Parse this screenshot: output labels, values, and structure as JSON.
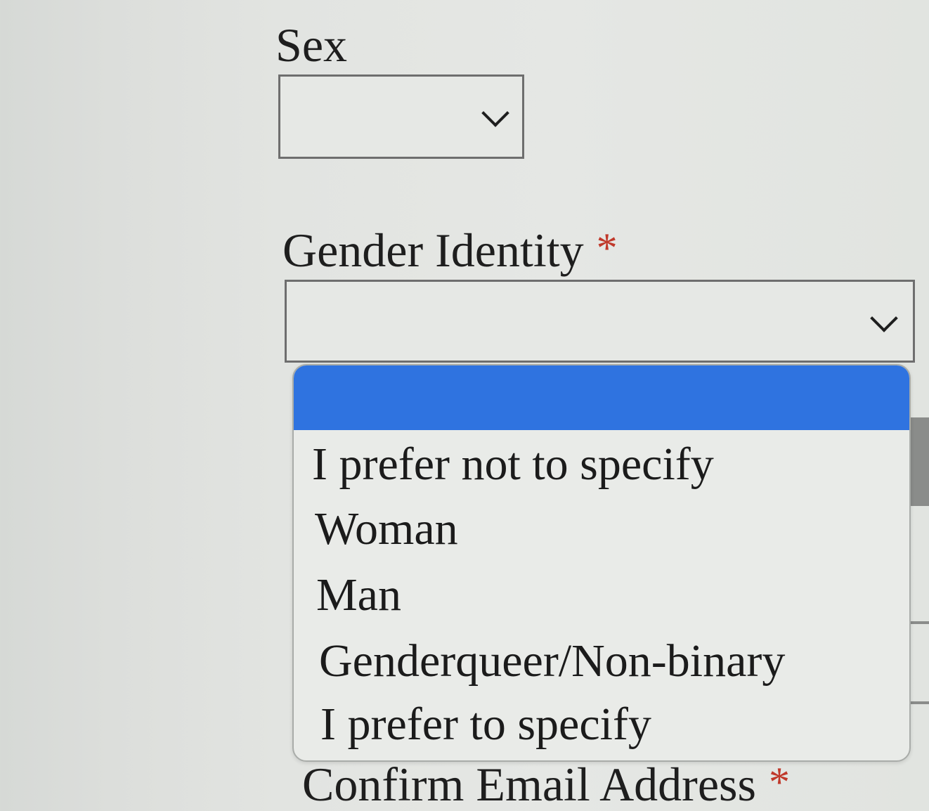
{
  "form": {
    "sex": {
      "label": "Sex",
      "selected_value": ""
    },
    "gender_identity": {
      "label": "Gender Identity",
      "required_marker": "*",
      "selected_value": "",
      "options": [
        {
          "label": "",
          "highlighted": true
        },
        {
          "label": "I prefer not to specify",
          "highlighted": false
        },
        {
          "label": "Woman",
          "highlighted": false
        },
        {
          "label": "Man",
          "highlighted": false
        },
        {
          "label": "Genderqueer/Non-binary",
          "highlighted": false
        },
        {
          "label": "I prefer to specify",
          "highlighted": false
        }
      ]
    },
    "confirm_email": {
      "label": "Confirm Email Address",
      "required_marker": "*"
    }
  },
  "colors": {
    "highlight": "#2f73e0",
    "required": "#c0392b"
  },
  "icons": {
    "select_arrow": "chevron-down-icon"
  }
}
